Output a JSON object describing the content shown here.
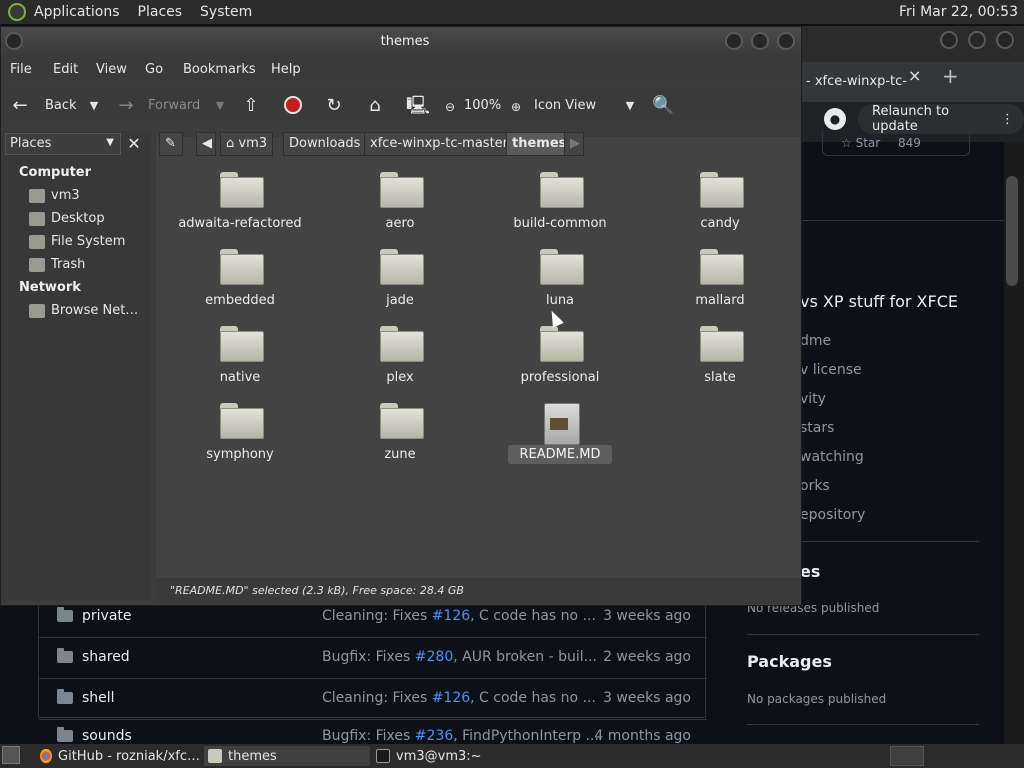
{
  "top_panel": {
    "menus": [
      "Applications",
      "Places",
      "System"
    ],
    "clock": "Fri Mar 22, 00:53"
  },
  "browser": {
    "tab_title": "- xfce-winxp-tc-",
    "tab_close": "×",
    "new_tab": "+",
    "relaunch_label": "Relaunch to update",
    "star_label": "Star",
    "star_count": "849",
    "about_title": "vs XP stuff for XFCE",
    "about_links": [
      "dme",
      "v license",
      "vity",
      "stars",
      "watching",
      "orks",
      "epository"
    ],
    "releases_heading": "es",
    "releases_note": "No releases published",
    "packages_heading": "Packages",
    "packages_note": "No packages published",
    "files": [
      {
        "name": "private",
        "msg_prefix": "Cleaning: Fixes ",
        "issue": "#126",
        "msg_suffix": ", C code has no ...",
        "age": "3 weeks ago"
      },
      {
        "name": "shared",
        "msg_prefix": "Bugfix: Fixes ",
        "issue": "#280",
        "msg_suffix": ", AUR broken - buil...",
        "age": "2 weeks ago"
      },
      {
        "name": "shell",
        "msg_prefix": "Cleaning: Fixes ",
        "issue": "#126",
        "msg_suffix": ", C code has no ...",
        "age": "3 weeks ago"
      },
      {
        "name": "sounds",
        "msg_prefix": "Bugfix: Fixes ",
        "issue": "#236",
        "msg_suffix": ", FindPythonInterp ...",
        "age": "4 months ago"
      }
    ]
  },
  "file_manager": {
    "title": "themes",
    "menus": [
      "File",
      "Edit",
      "View",
      "Go",
      "Bookmarks",
      "Help"
    ],
    "toolbar": {
      "back": "Back",
      "forward": "Forward",
      "zoom": "100%",
      "view_mode": "Icon View"
    },
    "sidebar": {
      "combo": "Places",
      "computer_heading": "Computer",
      "computer_items": [
        "vm3",
        "Desktop",
        "File System",
        "Trash"
      ],
      "network_heading": "Network",
      "network_items": [
        "Browse Net…"
      ]
    },
    "path": [
      "vm3",
      "Downloads",
      "xfce-winxp-tc-master",
      "themes"
    ],
    "items": [
      {
        "name": "adwaita-refactored",
        "type": "folder"
      },
      {
        "name": "aero",
        "type": "folder"
      },
      {
        "name": "build-common",
        "type": "folder"
      },
      {
        "name": "candy",
        "type": "folder"
      },
      {
        "name": "embedded",
        "type": "folder"
      },
      {
        "name": "jade",
        "type": "folder"
      },
      {
        "name": "luna",
        "type": "folder"
      },
      {
        "name": "mallard",
        "type": "folder"
      },
      {
        "name": "native",
        "type": "folder"
      },
      {
        "name": "plex",
        "type": "folder"
      },
      {
        "name": "professional",
        "type": "folder"
      },
      {
        "name": "slate",
        "type": "folder"
      },
      {
        "name": "symphony",
        "type": "folder"
      },
      {
        "name": "zune",
        "type": "folder"
      },
      {
        "name": "README.MD",
        "type": "document"
      }
    ],
    "status": "\"README.MD\" selected (2.3 kB), Free space: 28.4 GB"
  },
  "taskbar": {
    "tasks": [
      {
        "label": "GitHub - rozniak/xfc…",
        "icon": "chrome-icon"
      },
      {
        "label": "themes",
        "icon": "folder-icon"
      },
      {
        "label": "vm3@vm3:~",
        "icon": "terminal-icon"
      }
    ]
  }
}
